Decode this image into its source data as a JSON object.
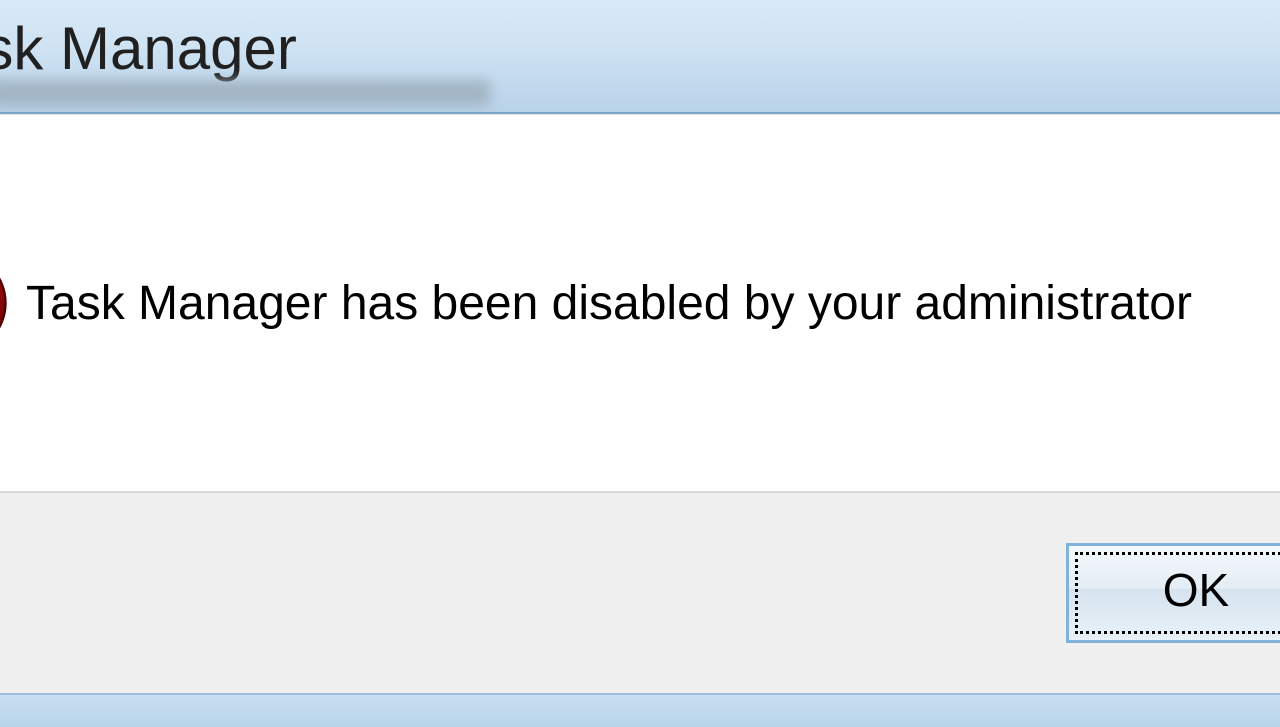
{
  "dialog": {
    "title": "Task Manager",
    "message": "Task Manager has been disabled by your administrator",
    "ok_label": "OK",
    "icon": "error-icon"
  }
}
